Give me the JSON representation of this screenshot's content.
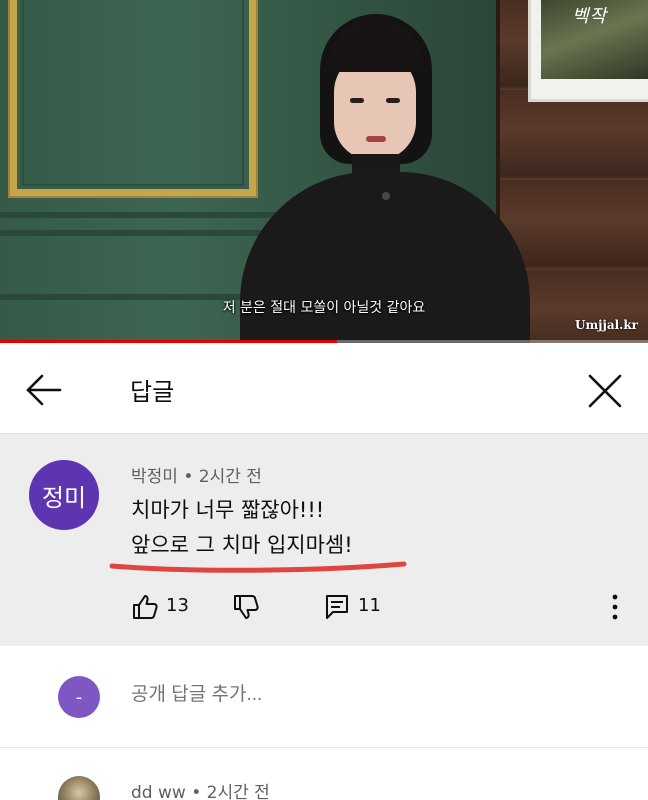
{
  "video": {
    "subtitle": "저 분은 절대 모쏠이 아닐것 같아요",
    "watermark": "Umjjal.kr",
    "picture_script": "벡작",
    "progress_fraction": 0.52,
    "progress_color": "#e60000"
  },
  "header": {
    "title": "답글",
    "back_icon": "arrow-left-icon",
    "close_icon": "close-icon"
  },
  "comment": {
    "avatar_text": "정미",
    "avatar_color": "#5e35b1",
    "author": "박정미",
    "separator": "•",
    "time": "2시간 전",
    "line1": "치마가 너무 짧잖아!!!",
    "line2": "앞으로 그 치마 입지마셈!",
    "underline_color": "#e0453f",
    "like_count": "13",
    "reply_count": "11"
  },
  "add_reply": {
    "avatar_text": "-",
    "avatar_color": "#7e57c2",
    "placeholder": "공개 답글 추가..."
  },
  "next_reply": {
    "author": "dd ww",
    "separator": "•",
    "time": "2시간 전"
  }
}
